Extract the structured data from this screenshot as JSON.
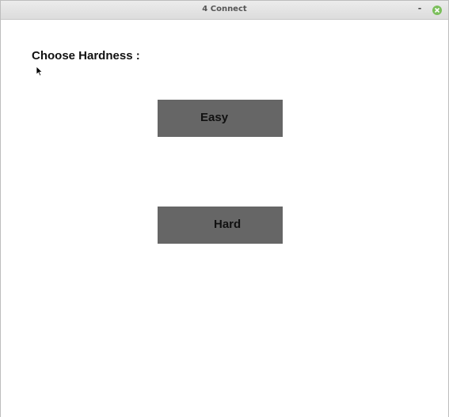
{
  "window": {
    "title": "4 Connect",
    "minimize_label": "-"
  },
  "content": {
    "prompt": "Choose Hardness :",
    "buttons": {
      "easy": "Easy",
      "hard": "Hard"
    }
  },
  "colors": {
    "button_bg": "#666666",
    "close_button": "#7bbf5b",
    "background": "#ffffff"
  },
  "icons": {
    "close": "close-icon",
    "cursor": "mouse-pointer-icon"
  }
}
